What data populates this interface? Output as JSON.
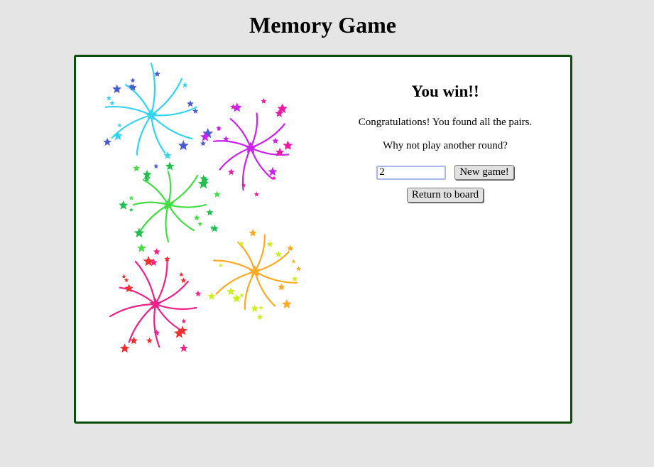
{
  "page": {
    "title": "Memory Game"
  },
  "win_panel": {
    "heading": "You win!!",
    "message": "Congratulations! You found all the pairs.",
    "prompt": "Why not play another round?",
    "pairs_input_value": "2",
    "new_game_label": "New game!",
    "return_label": "Return to board"
  },
  "colors": {
    "background": "#e5e5e5",
    "board_border": "#0a4d0a",
    "board_fill": "#ffffff"
  },
  "illustration": {
    "bursts": [
      {
        "name": "cyan-burst",
        "color": "#34d4f0",
        "star_color": "#4a5bd0"
      },
      {
        "name": "magenta-burst",
        "color": "#cc22ee",
        "star_color": "#e81aa8"
      },
      {
        "name": "green-burst",
        "color": "#44dd44",
        "star_color": "#22c050"
      },
      {
        "name": "orange-burst",
        "color": "#ffaa22",
        "star_color": "#ccee22"
      },
      {
        "name": "pink-burst",
        "color": "#ee2288",
        "star_color": "#ee3030"
      }
    ]
  }
}
